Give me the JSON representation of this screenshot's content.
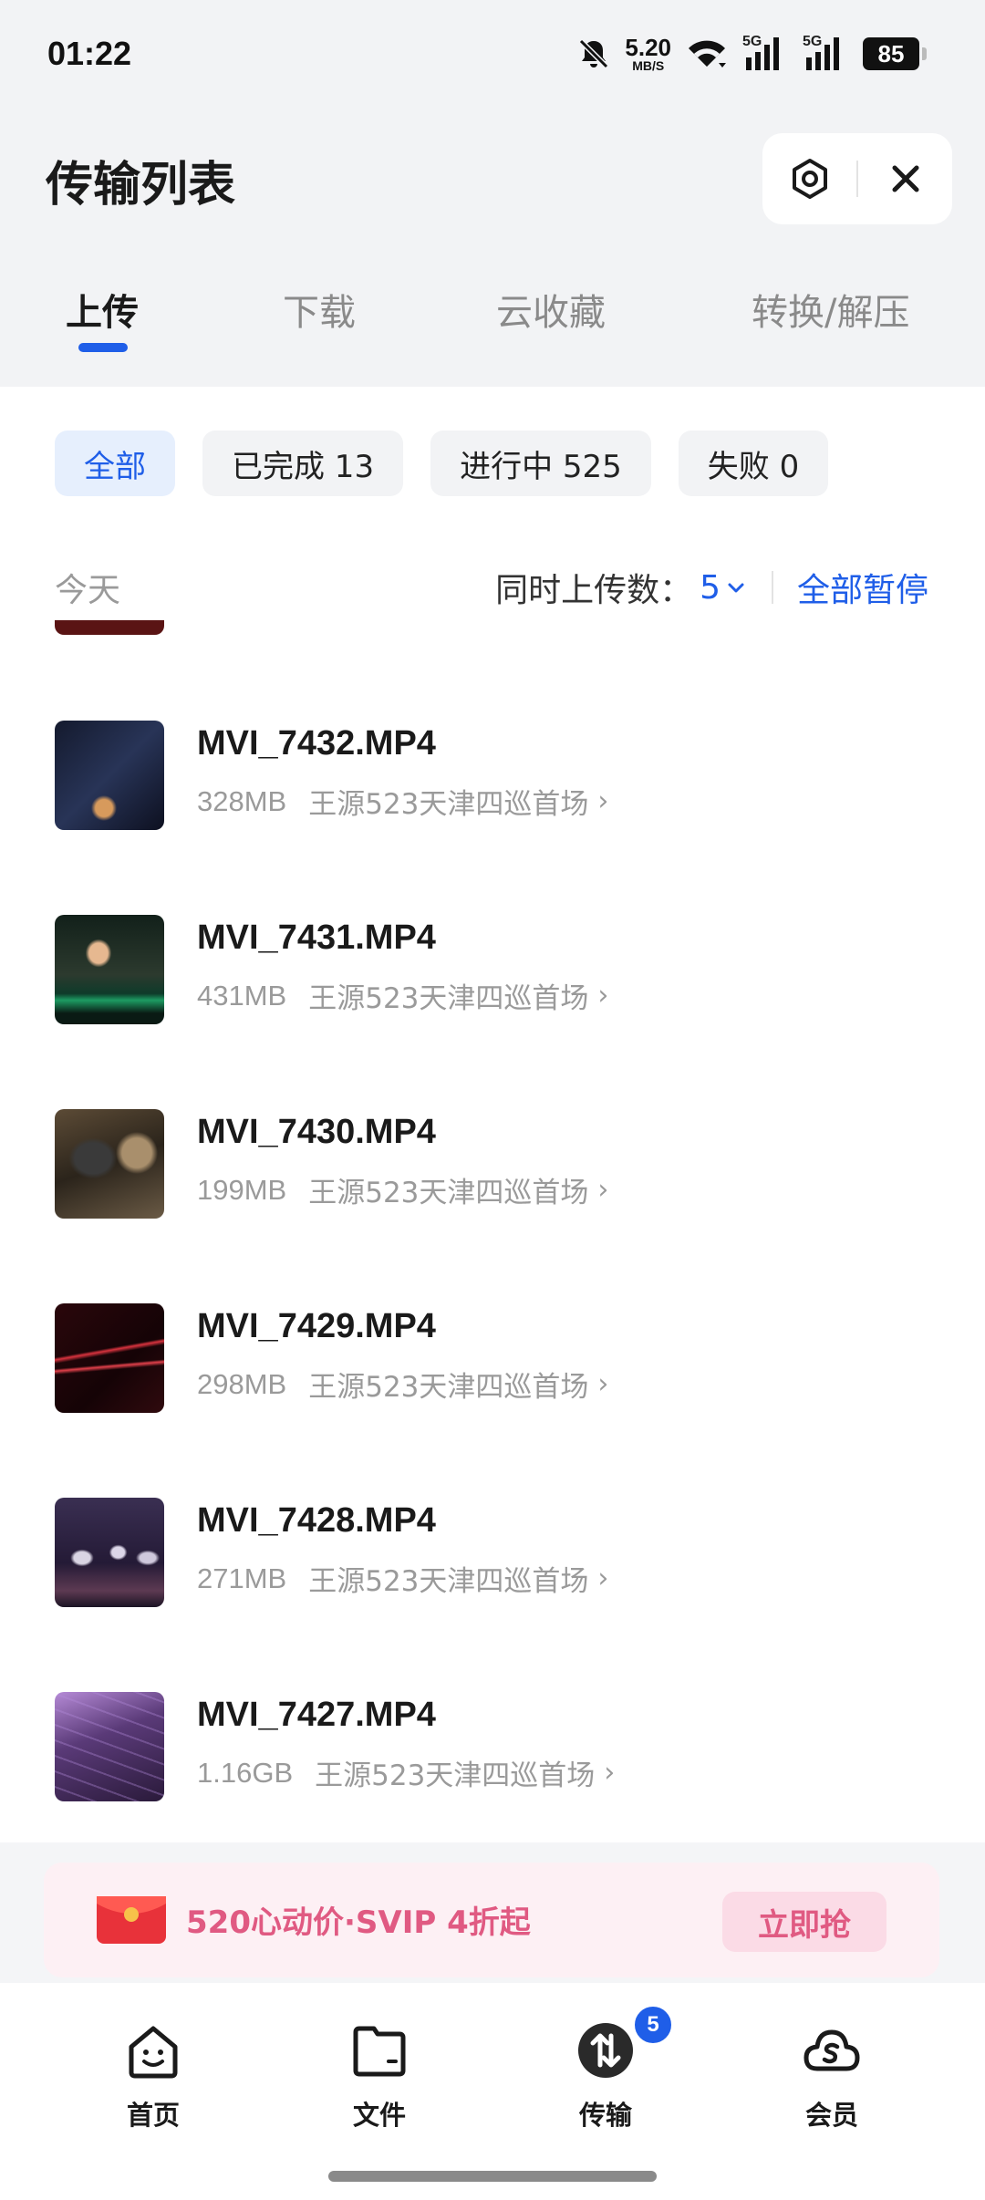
{
  "status_bar": {
    "time": "01:22",
    "net_speed_value": "5.20",
    "net_speed_unit": "MB/S",
    "signal1_label": "5G",
    "signal2_label": "5G",
    "battery": "85"
  },
  "header": {
    "title": "传输列表",
    "actions": [
      {
        "icon": "settings-hexagon-icon"
      },
      {
        "icon": "close-icon"
      }
    ]
  },
  "tabs": [
    {
      "label": "上传",
      "active": true
    },
    {
      "label": "下载",
      "active": false
    },
    {
      "label": "云收藏",
      "active": false
    },
    {
      "label": "转换/解压",
      "active": false
    }
  ],
  "filters": [
    {
      "label": "全部",
      "active": true
    },
    {
      "label": "已完成 13",
      "active": false
    },
    {
      "label": "进行中 525",
      "active": false
    },
    {
      "label": "失败 0",
      "active": false
    }
  ],
  "section": {
    "date_label": "今天",
    "concurrent_label": "同时上传数：",
    "concurrent_value": "5",
    "pause_all_label": "全部暂停"
  },
  "files": [
    {
      "name": "MVI_7432.MP4",
      "size": "328MB",
      "folder": "王源523天津四巡首场"
    },
    {
      "name": "MVI_7431.MP4",
      "size": "431MB",
      "folder": "王源523天津四巡首场"
    },
    {
      "name": "MVI_7430.MP4",
      "size": "199MB",
      "folder": "王源523天津四巡首场"
    },
    {
      "name": "MVI_7429.MP4",
      "size": "298MB",
      "folder": "王源523天津四巡首场"
    },
    {
      "name": "MVI_7428.MP4",
      "size": "271MB",
      "folder": "王源523天津四巡首场"
    },
    {
      "name": "MVI_7427.MP4",
      "size": "1.16GB",
      "folder": "王源523天津四巡首场"
    }
  ],
  "promo": {
    "text": "520心动价·SVIP 4折起",
    "button": "立即抢",
    "icon": "red-envelope-icon"
  },
  "bottom_nav": [
    {
      "label": "首页",
      "icon": "home-smile-icon"
    },
    {
      "label": "文件",
      "icon": "folder-icon"
    },
    {
      "label": "传输",
      "icon": "transfer-icon",
      "badge": "5",
      "active": true
    },
    {
      "label": "会员",
      "icon": "cloud-vip-icon"
    }
  ],
  "colors": {
    "accent": "#1f5ee8",
    "promo_pink": "#e05a82",
    "top_background": "#f2f3f5"
  }
}
